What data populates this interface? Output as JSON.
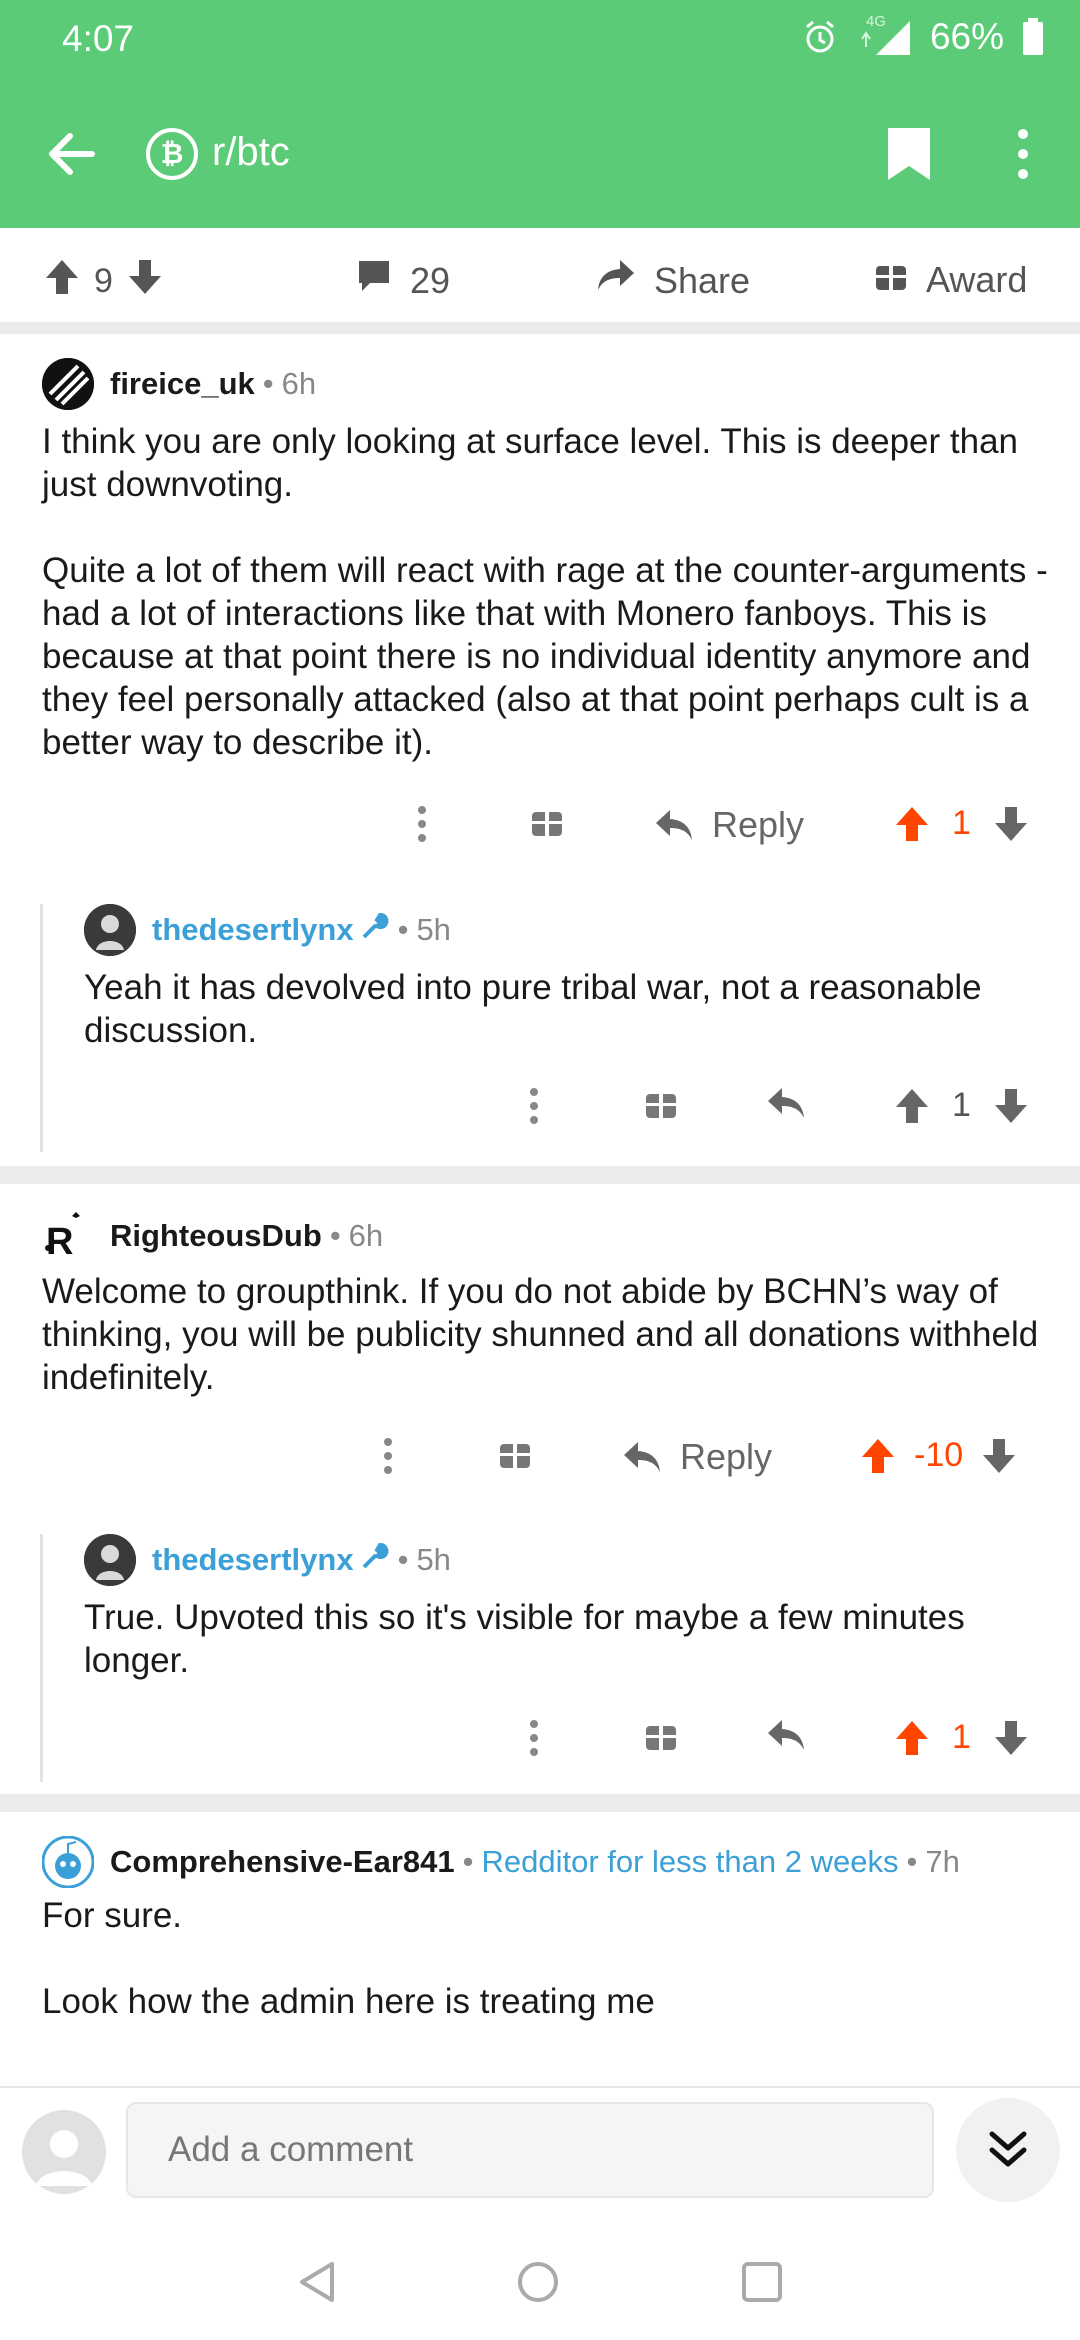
{
  "status_bar": {
    "time": "4:07",
    "network": "4G",
    "battery": "66%"
  },
  "header": {
    "subreddit": "r/btc",
    "sub_icon_glyph": "₿"
  },
  "post_actions": {
    "score": "9",
    "comments": "29",
    "share": "Share",
    "award": "Award"
  },
  "comments": [
    {
      "author": "fireice_uk",
      "age": "6h",
      "paragraphs": [
        "I think you are only looking at surface level. This is deeper than just downvoting.",
        "Quite a lot of them will react with rage at the counter-arguments - had a lot of interactions like that with Monero fanboys. This is because at that point there is no individual identity anymore and they feel personally attacked (also at that point perhaps cult is a better way to describe it)."
      ],
      "reply": "Reply",
      "score": "1",
      "upvoted": true
    },
    {
      "author": "thedesertlynx",
      "age": "5h",
      "paragraphs": [
        "Yeah it has devolved into pure tribal war, not a reasonable discussion."
      ],
      "score": "1",
      "upvoted": false
    },
    {
      "author": "RighteousDub",
      "age": "6h",
      "paragraphs": [
        "Welcome to groupthink. If you do not abide by BCHN’s way of thinking, you will be publicity shunned and all donations withheld indefinitely."
      ],
      "reply": "Reply",
      "score": "-10",
      "upvoted": true
    },
    {
      "author": "thedesertlynx",
      "age": "5h",
      "paragraphs": [
        "True. Upvoted this so it's visible for maybe a few minutes longer."
      ],
      "score": "1",
      "upvoted": true
    },
    {
      "author": "Comprehensive-Ear841",
      "flair": "Redditor for less than 2 weeks",
      "age": "7h",
      "paragraphs": [
        "For sure.",
        "Look how the admin here is treating me"
      ]
    }
  ],
  "composer": {
    "placeholder": "Add a comment"
  },
  "colors": {
    "header": "#5ccb78",
    "upvote": "#ff4500",
    "user_link": "#3b9fd8"
  }
}
